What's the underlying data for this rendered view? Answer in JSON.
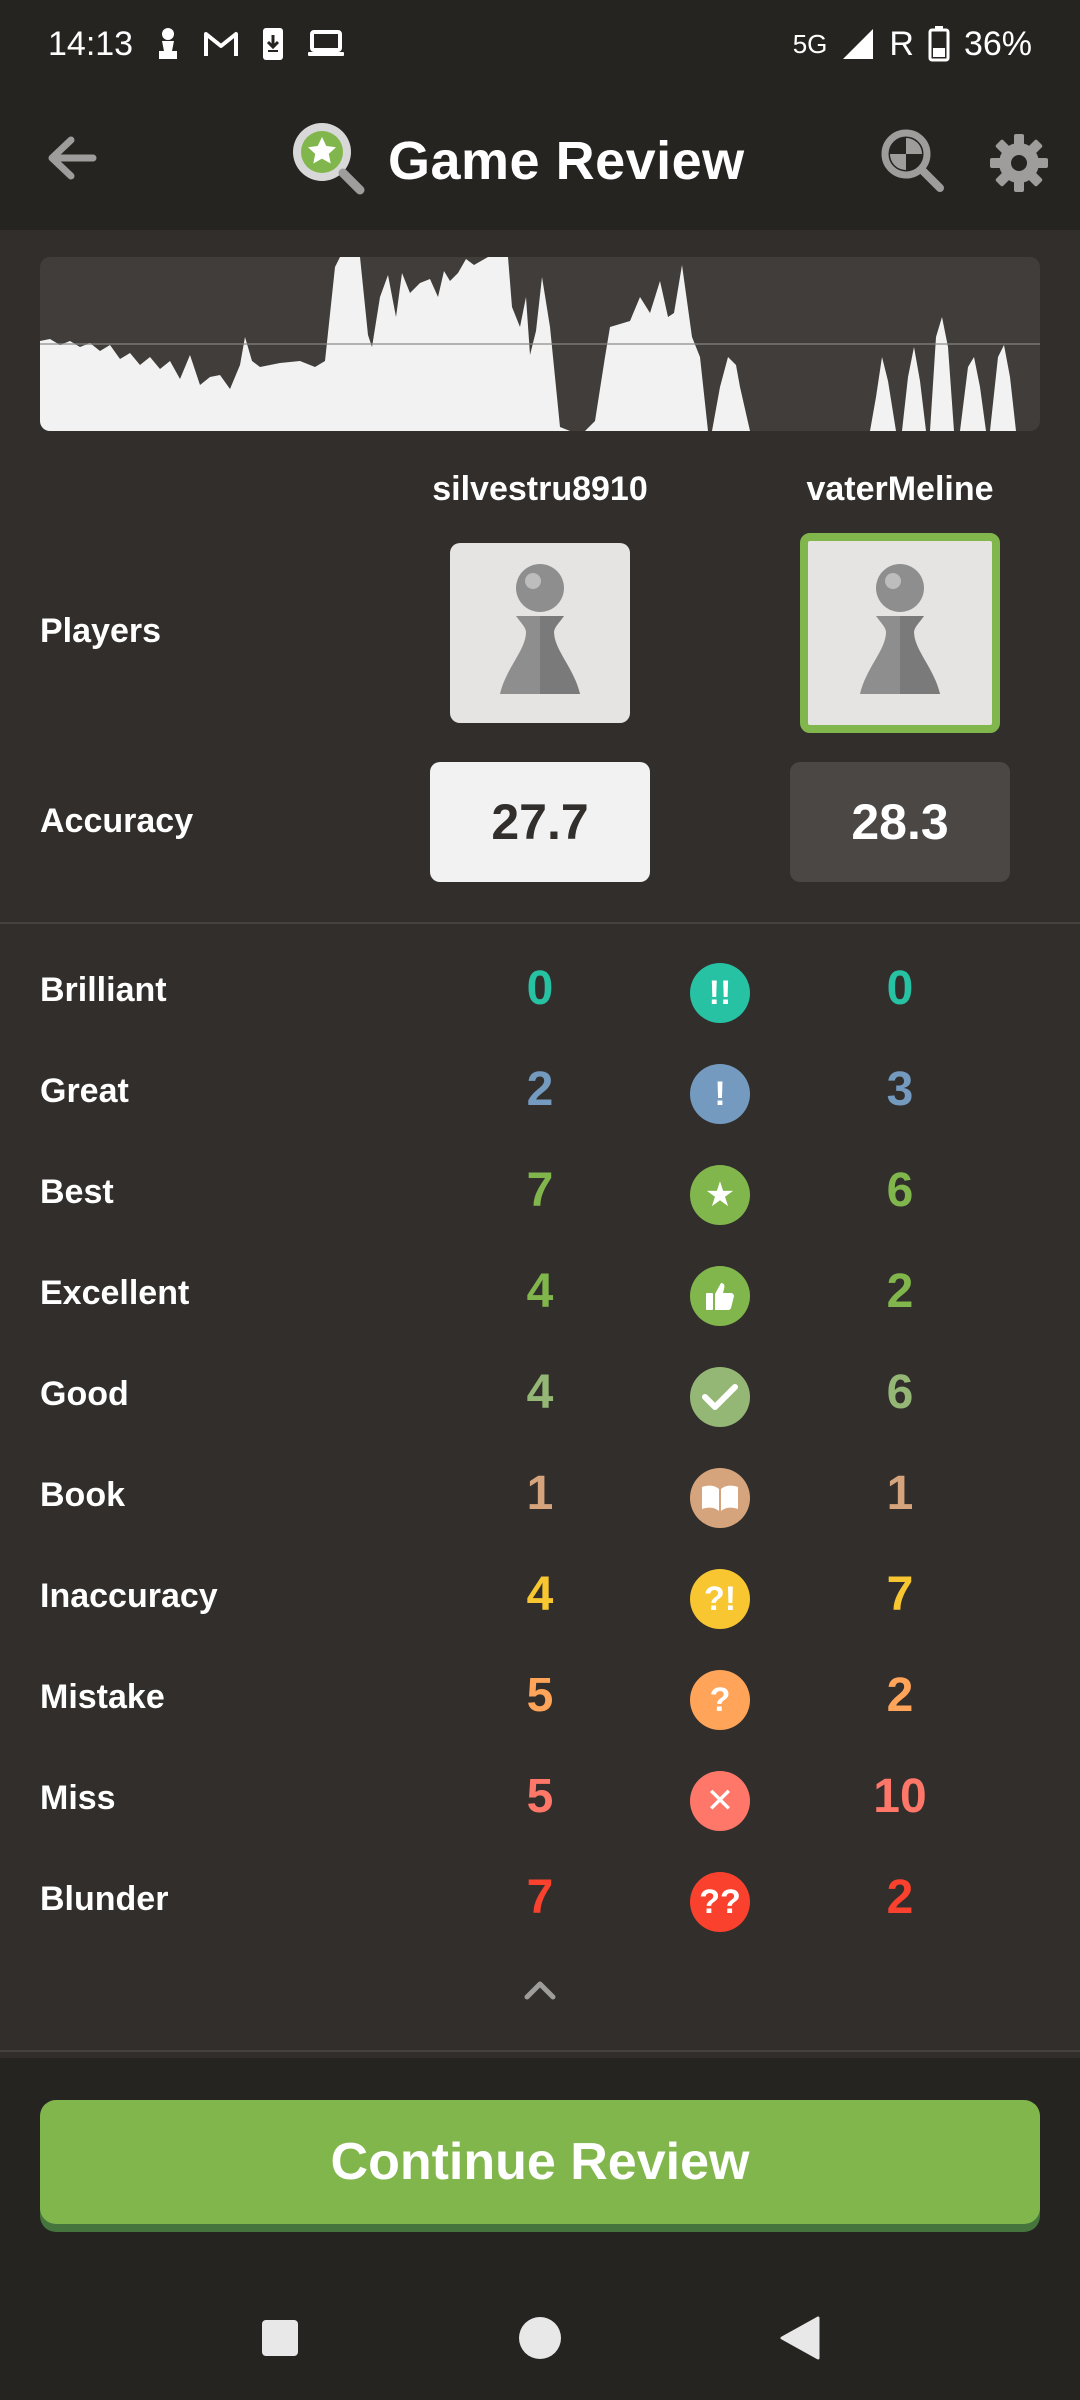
{
  "status_bar": {
    "time": "14:13",
    "network": "5G",
    "roaming": "R",
    "battery": "36%",
    "left_icons": [
      "chess-pawn-icon",
      "gmail-icon",
      "download-phone-icon",
      "laptop-icon"
    ]
  },
  "header": {
    "title": "Game Review",
    "icons": [
      "back-arrow-icon",
      "game-review-logo-icon",
      "analysis-icon",
      "settings-icon"
    ]
  },
  "players": {
    "label": "Players",
    "white_name": "silvestru8910",
    "black_name": "vaterMeline",
    "active": "black"
  },
  "accuracy": {
    "label": "Accuracy",
    "white": "27.7",
    "black": "28.3"
  },
  "stats": [
    {
      "label": "Brilliant",
      "white": "0",
      "black": "0",
      "symbol": "!!",
      "color": "#26c2a3",
      "icon": "brilliant-icon"
    },
    {
      "label": "Great",
      "white": "2",
      "black": "3",
      "symbol": "!",
      "color": "#749bbf",
      "icon": "great-icon"
    },
    {
      "label": "Best",
      "white": "7",
      "black": "6",
      "symbol": "★",
      "color": "#81b64c",
      "icon": "best-star-icon"
    },
    {
      "label": "Excellent",
      "white": "4",
      "black": "2",
      "symbol": "",
      "color": "#81b64c",
      "icon": "thumbs-up-icon"
    },
    {
      "label": "Good",
      "white": "4",
      "black": "6",
      "symbol": "✔",
      "color": "#95b776",
      "icon": "checkmark-icon"
    },
    {
      "label": "Book",
      "white": "1",
      "black": "1",
      "symbol": "",
      "color": "#d5a47d",
      "icon": "book-icon"
    },
    {
      "label": "Inaccuracy",
      "white": "4",
      "black": "7",
      "symbol": "?!",
      "color": "#f7c631",
      "icon": "inaccuracy-icon"
    },
    {
      "label": "Mistake",
      "white": "5",
      "black": "2",
      "symbol": "?",
      "color": "#ffa459",
      "icon": "mistake-icon"
    },
    {
      "label": "Miss",
      "white": "5",
      "black": "10",
      "symbol": "✕",
      "color": "#ff7769",
      "icon": "miss-x-icon"
    },
    {
      "label": "Blunder",
      "white": "7",
      "black": "2",
      "symbol": "??",
      "color": "#fa412d",
      "icon": "blunder-icon"
    }
  ],
  "continue_button": "Continue Review",
  "colors": {
    "background": "#312e2b",
    "bar": "#262421",
    "accent_green": "#81b64c"
  },
  "nav_icons": [
    "recents-square-icon",
    "home-circle-icon",
    "back-triangle-icon"
  ]
}
